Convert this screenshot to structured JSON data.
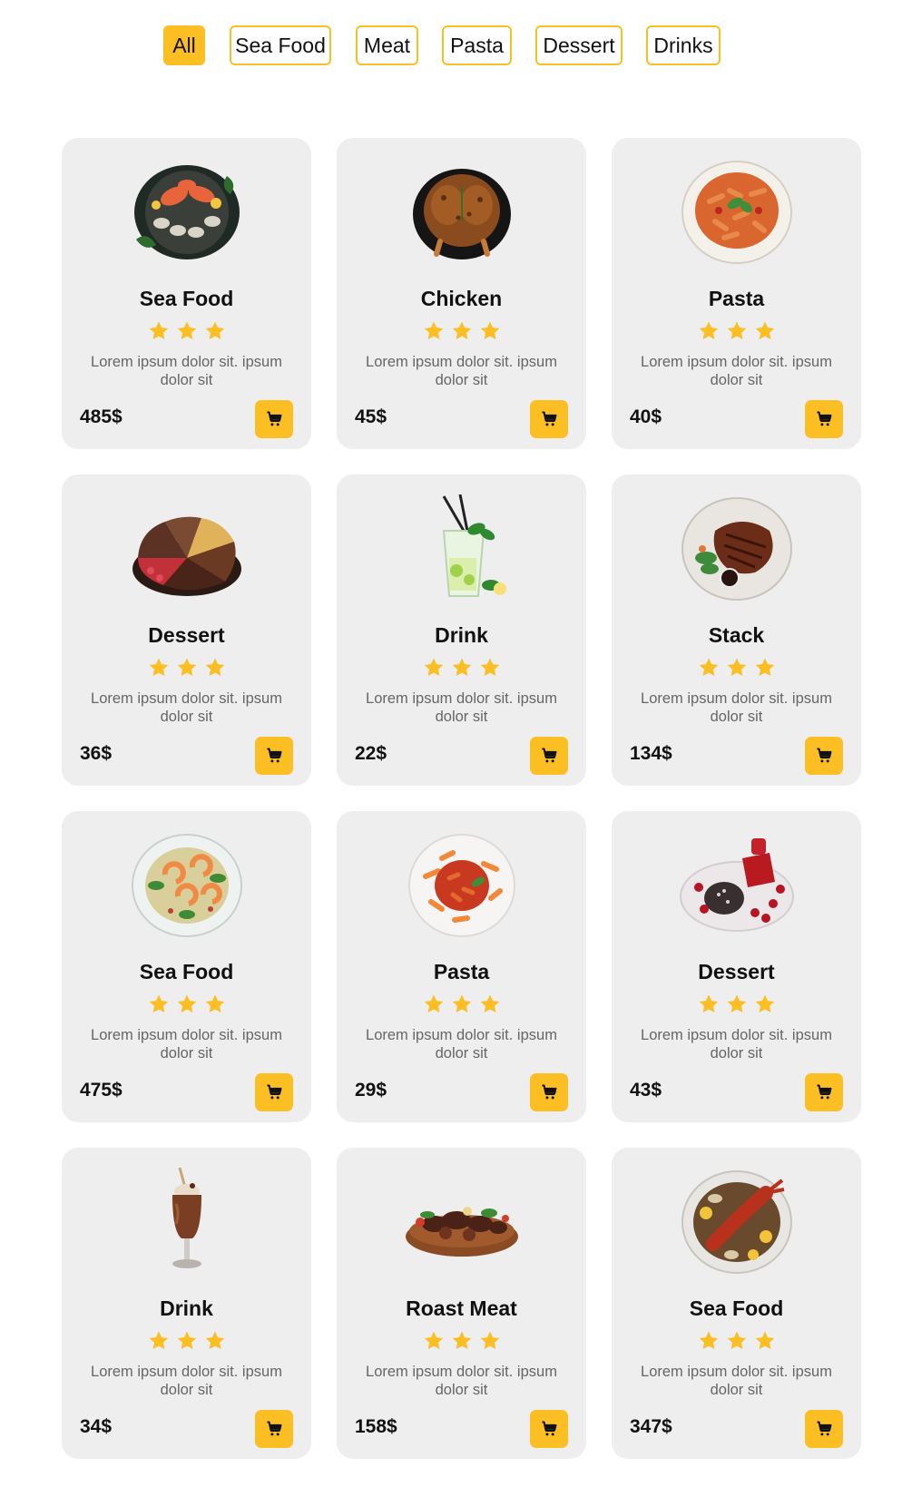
{
  "filters": [
    {
      "label": "All",
      "active": true
    },
    {
      "label": "Sea Food",
      "active": false
    },
    {
      "label": "Meat",
      "active": false
    },
    {
      "label": "Pasta",
      "active": false
    },
    {
      "label": "Dessert",
      "active": false
    },
    {
      "label": "Drinks",
      "active": false
    }
  ],
  "colors": {
    "accent": "#fbbf24",
    "card_bg": "#eeeeee",
    "description": "#666666"
  },
  "products": [
    {
      "title": "Sea Food",
      "description": "Lorem ipsum dolor sit. ipsum dolor sit",
      "price": "485$",
      "rating": 3,
      "image": "seafood-platter"
    },
    {
      "title": "Chicken",
      "description": "Lorem ipsum dolor sit. ipsum dolor sit",
      "price": "45$",
      "rating": 3,
      "image": "roast-chicken"
    },
    {
      "title": "Pasta",
      "description": "Lorem ipsum dolor sit. ipsum dolor sit",
      "price": "40$",
      "rating": 3,
      "image": "penne-plate"
    },
    {
      "title": "Dessert",
      "description": "Lorem ipsum dolor sit. ipsum dolor sit",
      "price": "36$",
      "rating": 3,
      "image": "cake-slices"
    },
    {
      "title": "Drink",
      "description": "Lorem ipsum dolor sit. ipsum dolor sit",
      "price": "22$",
      "rating": 3,
      "image": "mojito-glass"
    },
    {
      "title": "Stack",
      "description": "Lorem ipsum dolor sit. ipsum dolor sit",
      "price": "134$",
      "rating": 3,
      "image": "steak-plate"
    },
    {
      "title": "Sea Food",
      "description": "Lorem ipsum dolor sit. ipsum dolor sit",
      "price": "475$",
      "rating": 3,
      "image": "shrimp-salad"
    },
    {
      "title": "Pasta",
      "description": "Lorem ipsum dolor sit. ipsum dolor sit",
      "price": "29$",
      "rating": 3,
      "image": "penne-sauce"
    },
    {
      "title": "Dessert",
      "description": "Lorem ipsum dolor sit. ipsum dolor sit",
      "price": "43$",
      "rating": 3,
      "image": "berry-dessert"
    },
    {
      "title": "Drink",
      "description": "Lorem ipsum dolor sit. ipsum dolor sit",
      "price": "34$",
      "rating": 3,
      "image": "chocolate-shake"
    },
    {
      "title": "Roast Meat",
      "description": "Lorem ipsum dolor sit. ipsum dolor sit",
      "price": "158$",
      "rating": 3,
      "image": "roast-meat-board"
    },
    {
      "title": "Sea Food",
      "description": "Lorem ipsum dolor sit. ipsum dolor sit",
      "price": "347$",
      "rating": 3,
      "image": "lobster-plate"
    }
  ]
}
